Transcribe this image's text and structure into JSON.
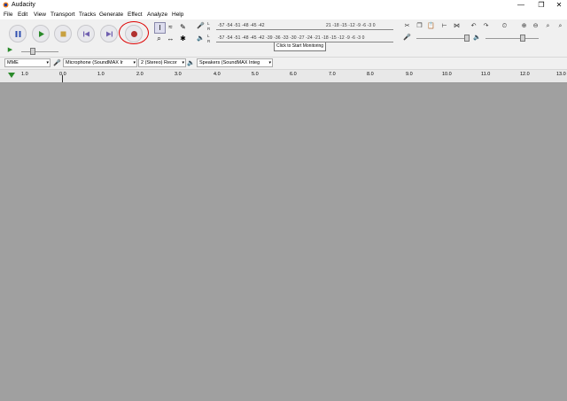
{
  "app": {
    "title": "Audacity"
  },
  "window_controls": {
    "minimize": "—",
    "maximize": "❐",
    "close": "✕"
  },
  "menu": [
    "File",
    "Edit",
    "View",
    "Transport",
    "Tracks",
    "Generate",
    "Effect",
    "Analyze",
    "Help"
  ],
  "meters": {
    "record_lr_top": "L",
    "record_lr_bottom": "R",
    "record_scale": "-57 -54 -51 -48 -45 -42",
    "record_scale_right": "21 -18 -15 -12  -9  -6  -3  0",
    "playback_lr_top": "L",
    "playback_lr_bottom": "R",
    "playback_scale": "-57 -54 -51 -48 -45 -42 -39 -36 -33 -30 -27 -24 -21 -18 -15 -12  -9  -6  -3  0",
    "tooltip": "Click to Start Monitoring"
  },
  "device": {
    "host": "MME",
    "recording_device": "Microphone (SoundMAX Ir",
    "channels": "2 (Stereo) Recor",
    "playback_device": "Speakers (SoundMAX Integ"
  },
  "ruler": {
    "ticks": [
      "1.0",
      "0.0",
      "1.0",
      "2.0",
      "3.0",
      "4.0",
      "5.0",
      "6.0",
      "7.0",
      "8.0",
      "9.0",
      "10.0",
      "11.0",
      "12.0",
      "13.0"
    ]
  },
  "colors": {
    "record_red": "#b03030",
    "play_green": "#2a8a2a",
    "annotation_red": "#dd0000",
    "background": "#a0a0a0"
  }
}
